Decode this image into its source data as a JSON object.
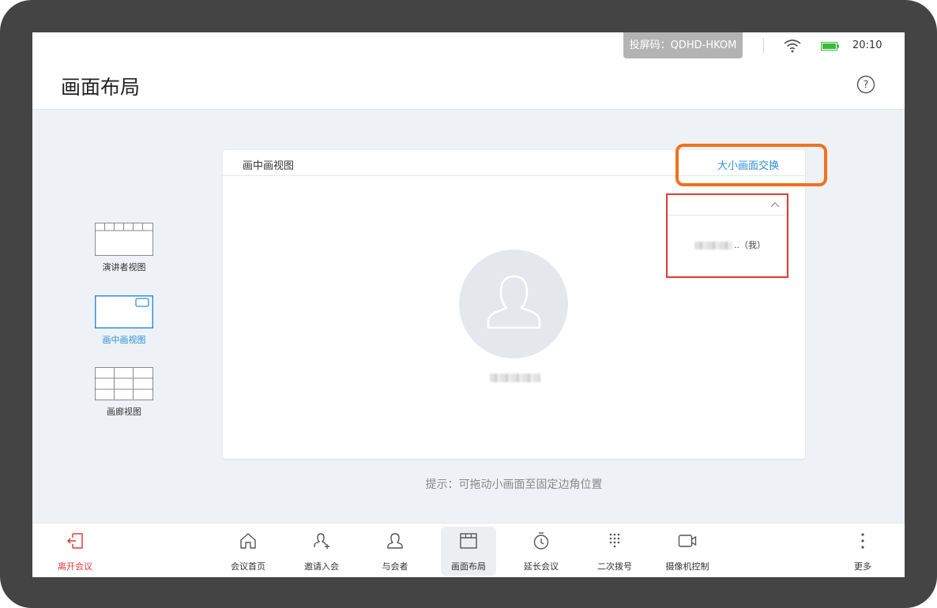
{
  "status_bar": {
    "cast_code": "投屏码：QDHD-HKOM",
    "time": "20:10",
    "icons": [
      "wifi-icon",
      "battery-icon"
    ]
  },
  "header": {
    "title": "画面布局",
    "help_icon": "question-circle-icon"
  },
  "layouts": [
    {
      "label": "演讲者视图",
      "icon": "speaker-view-icon",
      "active": false
    },
    {
      "label": "画中画视图",
      "icon": "picture-in-picture-icon",
      "active": true
    },
    {
      "label": "画廊视图",
      "icon": "gallery-grid-icon",
      "active": false
    }
  ],
  "main_card": {
    "title": "画中画视图",
    "swap_label": "大小画面交换",
    "pip_suffix": "..（我）",
    "avatar_icon": "person-avatar-icon"
  },
  "hint": "提示：可拖动小画面至固定边角位置",
  "toolbar": {
    "leave": "离开会议",
    "items": [
      {
        "label": "会议首页",
        "icon": "home-icon"
      },
      {
        "label": "邀请入会",
        "icon": "add-person-icon"
      },
      {
        "label": "与会者",
        "icon": "person-icon"
      },
      {
        "label": "画面布局",
        "icon": "layout-icon",
        "active": true
      },
      {
        "label": "延长会议",
        "icon": "timer-icon"
      },
      {
        "label": "二次拨号",
        "icon": "dialpad-icon"
      },
      {
        "label": "摄像机控制",
        "icon": "camera-icon"
      },
      {
        "label": "更多",
        "icon": "more-vertical-icon"
      }
    ]
  },
  "colors": {
    "accent": "#2f8fd6",
    "leave": "#e03a3a",
    "annotation_orange": "#f2711c",
    "annotation_red": "#e03a3a"
  }
}
